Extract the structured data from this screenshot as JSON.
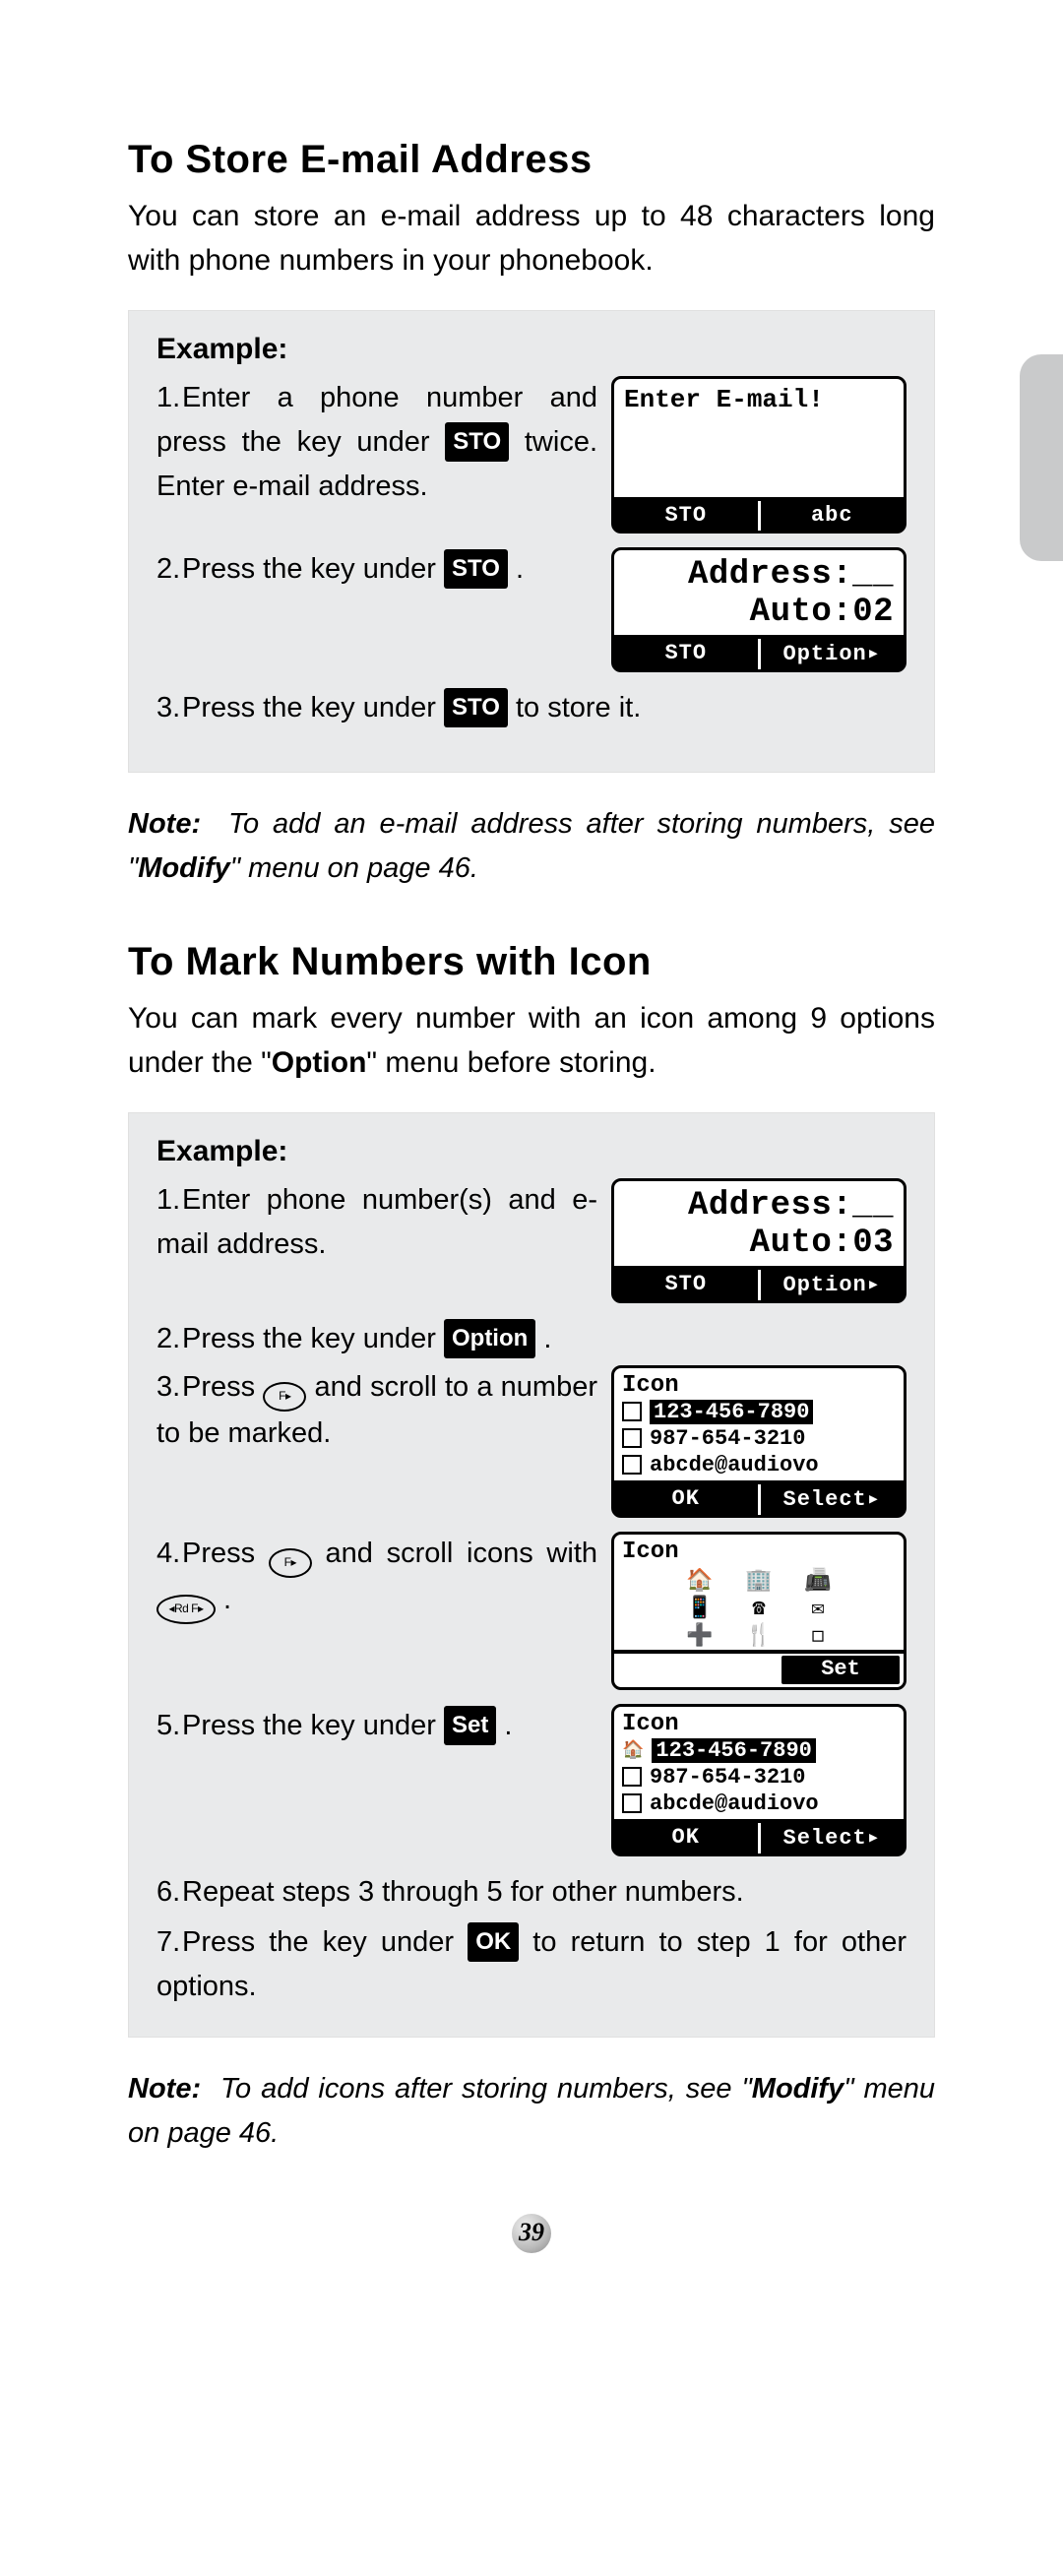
{
  "section1": {
    "title": "To Store E-mail Address",
    "intro": "You can store an e-mail address up to 48 characters long with phone numbers in your phonebook.",
    "example_label": "Example:",
    "step1_a": "Enter a phone number and press the key under ",
    "step1_key": "STO",
    "step1_b": " twice. Enter e-mail address.",
    "step2_a": "Press the key under ",
    "step2_key": "STO",
    "step2_b": " .",
    "step3_a": "Press the key under ",
    "step3_key": "STO",
    "step3_b": " to store it.",
    "screen1": {
      "line1": "Enter E-mail!",
      "foot_l": "STO",
      "foot_r": "abc"
    },
    "screen2": {
      "line1": "Address:__",
      "line2": "Auto:02",
      "foot_l": "STO",
      "foot_r": "Option▸"
    },
    "note_label": "Note:",
    "note_a": "To add an e-mail address after storing numbers, see \"",
    "note_bold": "Modify",
    "note_b": "\" menu on page 46."
  },
  "section2": {
    "title": "To Mark Numbers with Icon",
    "intro_a": "You can mark every number with an icon among 9 options under the \"",
    "intro_bold": "Option",
    "intro_b": "\" menu before storing.",
    "example_label": "Example:",
    "step1": "Enter phone number(s) and e-mail address.",
    "step2_a": "Press the key under ",
    "step2_key": "Option",
    "step2_b": " .",
    "step3_a": "Press ",
    "step3_key": "F▸",
    "step3_b": " and scroll to a number to be marked.",
    "step4_a": "Press ",
    "step4_key1": "F▸",
    "step4_b": " and scroll icons with ",
    "step4_key2": "◂Rd F▸",
    "step4_c": " .",
    "step5_a": "Press the key under ",
    "step5_key": "Set",
    "step5_b": " .",
    "step6": "Repeat steps 3 through 5 for other numbers.",
    "step7_a": "Press the key under ",
    "step7_key": "OK",
    "step7_b": " to return to step 1 for other options.",
    "screen1": {
      "line1": "Address:__",
      "line2": "Auto:03",
      "foot_l": "STO",
      "foot_r": "Option▸"
    },
    "screen2": {
      "title": "Icon",
      "row1": "123-456-7890",
      "row2": "987-654-3210",
      "row3": "abcde@audiovo",
      "foot_l": "OK",
      "foot_r": "Select▸"
    },
    "screen3": {
      "title": "Icon",
      "foot_r": "Set"
    },
    "screen4": {
      "title": "Icon",
      "row1": "123-456-7890",
      "row2": "987-654-3210",
      "row3": "abcde@audiovo",
      "foot_l": "OK",
      "foot_r": "Select▸"
    },
    "note_label": "Note:",
    "note_a": "To add icons after storing numbers, see \"",
    "note_bold": "Modify",
    "note_b": "\" menu on page 46."
  },
  "page_number": "39"
}
